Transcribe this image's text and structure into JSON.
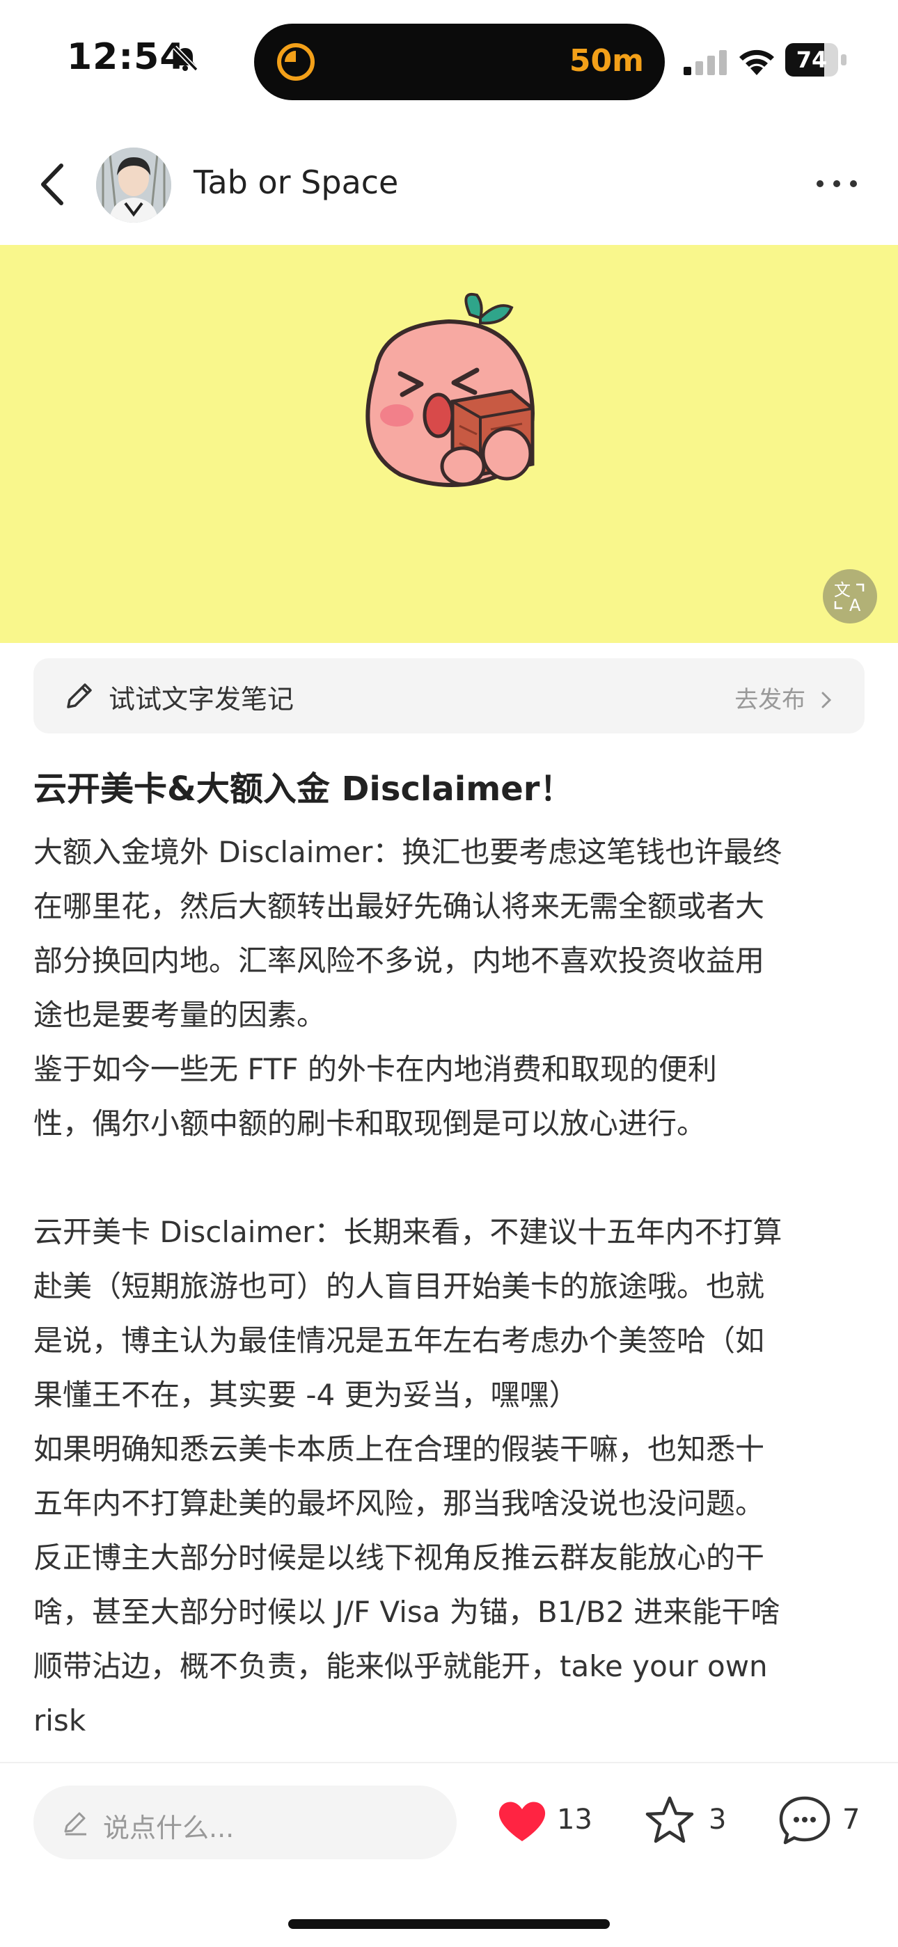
{
  "status_bar": {
    "time": "12:54",
    "island_timer": "50m",
    "battery": "74",
    "battery_level": 0.74,
    "accent_color": "#f3a019"
  },
  "header": {
    "author": "Tab or Space"
  },
  "note": {
    "banner_color": "#f9f78c",
    "title": "云开美卡&大额入金 Disclaimer！",
    "lines": [
      "大额入金境外 Disclaimer：换汇也要考虑这笔钱也许最终",
      "在哪里花，然后大额转出最好先确认将来无需全额或者大",
      "部分换回内地。汇率风险不多说，内地不喜欢投资收益用",
      "途也是要考量的因素。",
      "鉴于如今一些无 FTF 的外卡在内地消费和取现的便利",
      "性，偶尔小额中额的刷卡和取现倒是可以放心进行。",
      "",
      "云开美卡 Disclaimer：长期来看，不建议十五年内不打算",
      "赴美（短期旅游也可）的人盲目开始美卡的旅途哦。也就",
      "是说，博主认为最佳情况是五年左右考虑办个美签哈（如",
      "果懂王不在，其实要 -4 更为妥当，嘿嘿）",
      "如果明确知悉云美卡本质上在合理的假装干嘛，也知悉十",
      "五年内不打算赴美的最坏风险，那当我啥没说也没问题。",
      "反正博主大部分时候是以线下视角反推云群友能放心的干",
      "啥，甚至大部分时候以 J/F Visa 为锚，B1/B2 进来能干啥",
      "顺带沾边，概不负责，能来似乎就能开，take your own",
      "risk"
    ]
  },
  "try_bar": {
    "label": "试试文字发笔记",
    "action": "去发布"
  },
  "bottom_bar": {
    "comment_placeholder": "说点什么...",
    "likes": "13",
    "stars": "3",
    "comments": "7",
    "like_color": "#ff2442"
  }
}
